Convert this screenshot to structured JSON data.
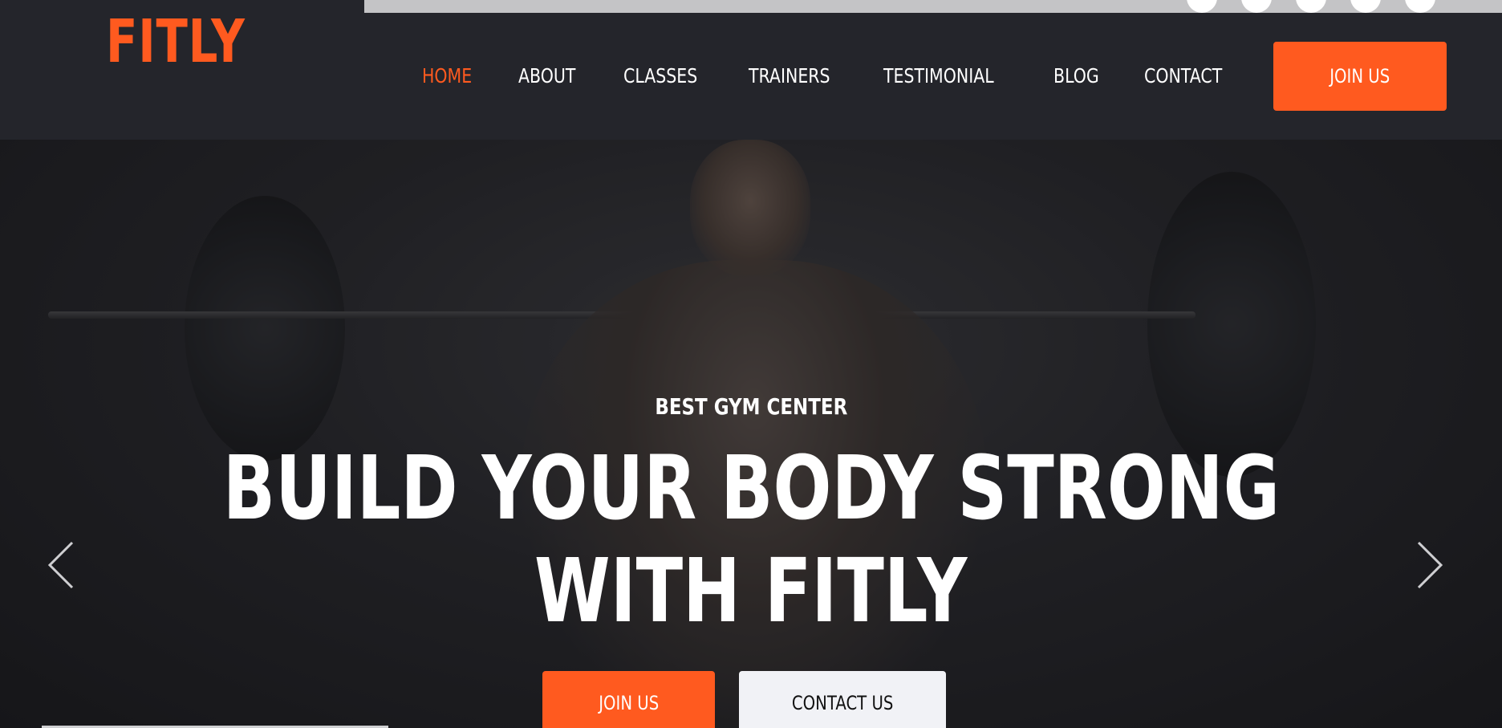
{
  "brand": {
    "logo": "FITLY",
    "accent": "#ff5a1f"
  },
  "nav": {
    "items": [
      {
        "label": "HOME",
        "active": true
      },
      {
        "label": "ABOUT",
        "active": false
      },
      {
        "label": "CLASSES",
        "active": false
      },
      {
        "label": "TRAINERS",
        "active": false
      },
      {
        "label": "TESTIMONIAL",
        "active": false
      },
      {
        "label": "BLOG",
        "active": false
      },
      {
        "label": "CONTACT",
        "active": false
      }
    ],
    "join_label": "JOIN US"
  },
  "social": [
    "social-icon",
    "social-icon",
    "social-icon",
    "social-icon",
    "social-icon"
  ],
  "hero": {
    "subtitle": "BEST GYM CENTER",
    "headline_line1": "BUILD YOUR BODY STRONG",
    "headline_line2": "WITH FITLY",
    "join_button": "JOIN US",
    "contact_button": "CONTACT US",
    "prev_icon": "chevron-left-icon",
    "next_icon": "chevron-right-icon"
  }
}
